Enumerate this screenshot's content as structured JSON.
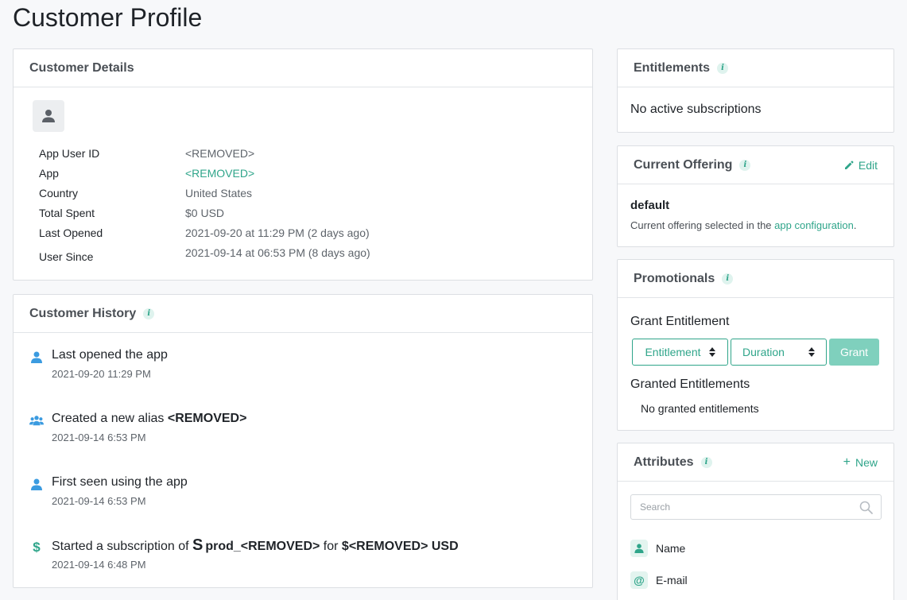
{
  "page": {
    "title": "Customer Profile"
  },
  "details": {
    "title": "Customer Details",
    "rows": [
      {
        "label": "App User ID",
        "value": "<REMOVED>"
      },
      {
        "label": "App",
        "value": "<REMOVED>"
      },
      {
        "label": "Country",
        "value": "United States"
      },
      {
        "label": "Total Spent",
        "value": "$0 USD"
      },
      {
        "label": "Last Opened",
        "value": "2021-09-20 at 11:29 PM (2 days ago)"
      },
      {
        "label": "User Since",
        "value": "2021-09-14 at 06:53 PM (8 days ago)"
      }
    ]
  },
  "history": {
    "title": "Customer History",
    "events": [
      {
        "icon": "person-icon",
        "text": "Last opened the app",
        "time": "2021-09-20 11:29 PM"
      },
      {
        "icon": "users-icon",
        "text": "Created a new alias ",
        "bold": "<REMOVED>",
        "time": "2021-09-14 6:53 PM"
      },
      {
        "icon": "person-icon",
        "text": "First seen using the app",
        "time": "2021-09-14 6:53 PM"
      },
      {
        "icon": "dollar-icon",
        "text_pre": "Started a subscription of ",
        "product": "prod_<REMOVED>",
        "text_mid": " for ",
        "amount": "$<REMOVED> USD",
        "time": "2021-09-14 6:48 PM"
      }
    ]
  },
  "entitlements": {
    "title": "Entitlements",
    "empty": "No active subscriptions"
  },
  "offering": {
    "title": "Current Offering",
    "edit_label": "Edit",
    "name": "default",
    "desc_pre": "Current offering selected in the ",
    "desc_link": "app configuration",
    "desc_post": "."
  },
  "promo": {
    "title": "Promotionals",
    "grant_heading": "Grant Entitlement",
    "entitlement_select": "Entitlement",
    "duration_select": "Duration",
    "grant_button": "Grant",
    "granted_heading": "Granted Entitlements",
    "granted_empty": "No granted entitlements"
  },
  "attributes": {
    "title": "Attributes",
    "new_label": "New",
    "search_placeholder": "Search",
    "items": [
      {
        "icon": "person-icon",
        "label": "Name"
      },
      {
        "icon": "at-icon",
        "label": "E-mail"
      }
    ]
  },
  "colors": {
    "accent": "#2fa58a",
    "person_icon": "#3b9be0"
  }
}
